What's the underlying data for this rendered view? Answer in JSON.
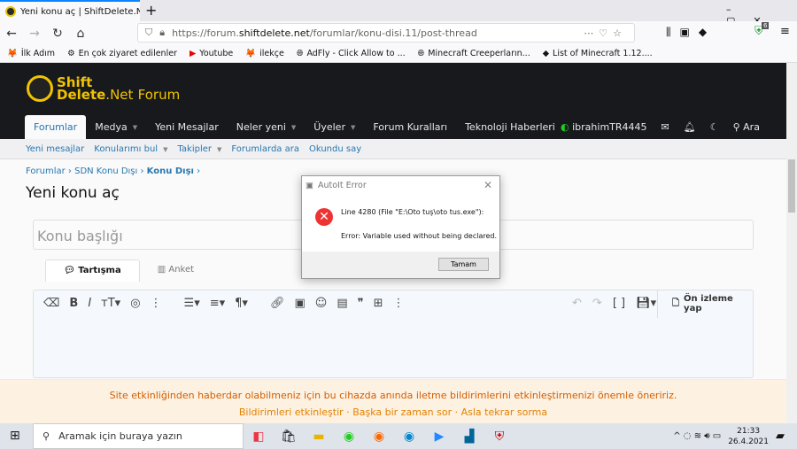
{
  "browser": {
    "tab_title": "Yeni konu aç | ShiftDelete.Net F",
    "url_prefix": "https://forum.",
    "url_domain": "shiftdelete.net",
    "url_path": "/forumlar/konu-disi.11/post-thread",
    "badge": "6",
    "bookmarks": [
      "İlk Adım",
      "En çok ziyaret edilenler",
      "Youtube",
      "ilekçe",
      "AdFly - Click Allow to ...",
      "Minecraft Creeperların...",
      "List of Minecraft 1.12...."
    ]
  },
  "site": {
    "logo_line1": "Shift",
    "logo_line2": "Delete",
    "logo_net": ".Net",
    "logo_forum": "Forum",
    "nav": [
      "Forumlar",
      "Medya",
      "Yeni Mesajlar",
      "Neler yeni",
      "Üyeler",
      "Forum Kuralları",
      "Teknoloji Haberleri"
    ],
    "username": "ibrahimTR4445",
    "search": "Ara",
    "subnav": [
      "Yeni mesajlar",
      "Konularımı bul",
      "Takipler",
      "Forumlarda ara",
      "Okundu say"
    ],
    "breadcrumb": [
      "Forumlar",
      "SDN Konu Dışı",
      "Konu Dışı"
    ],
    "page_title": "Yeni konu aç",
    "subject_placeholder": "Konu başlığı",
    "tabs": [
      "Tartışma",
      "Anket"
    ],
    "preview": "Ön izleme yap"
  },
  "notice": {
    "text": "Site etkinliğinden haberdar olabilmeniz için bu cihazda anında iletme bildirimlerini etkinleştirmenizi önemle öneririz.",
    "links": [
      "Bildirimleri etkinleştir",
      "Başka bir zaman sor",
      "Asla tekrar sorma"
    ],
    "sep": " · "
  },
  "dialog": {
    "title": "AutoIt Error",
    "line1": "Line 4280  (File \"E:\\Oto tuş\\oto tus.exe\"):",
    "line2": "Error: Variable used without being declared.",
    "ok": "Tamam"
  },
  "taskbar": {
    "search": "Aramak için buraya yazın",
    "time": "21:33",
    "date": "26.4.2021"
  }
}
